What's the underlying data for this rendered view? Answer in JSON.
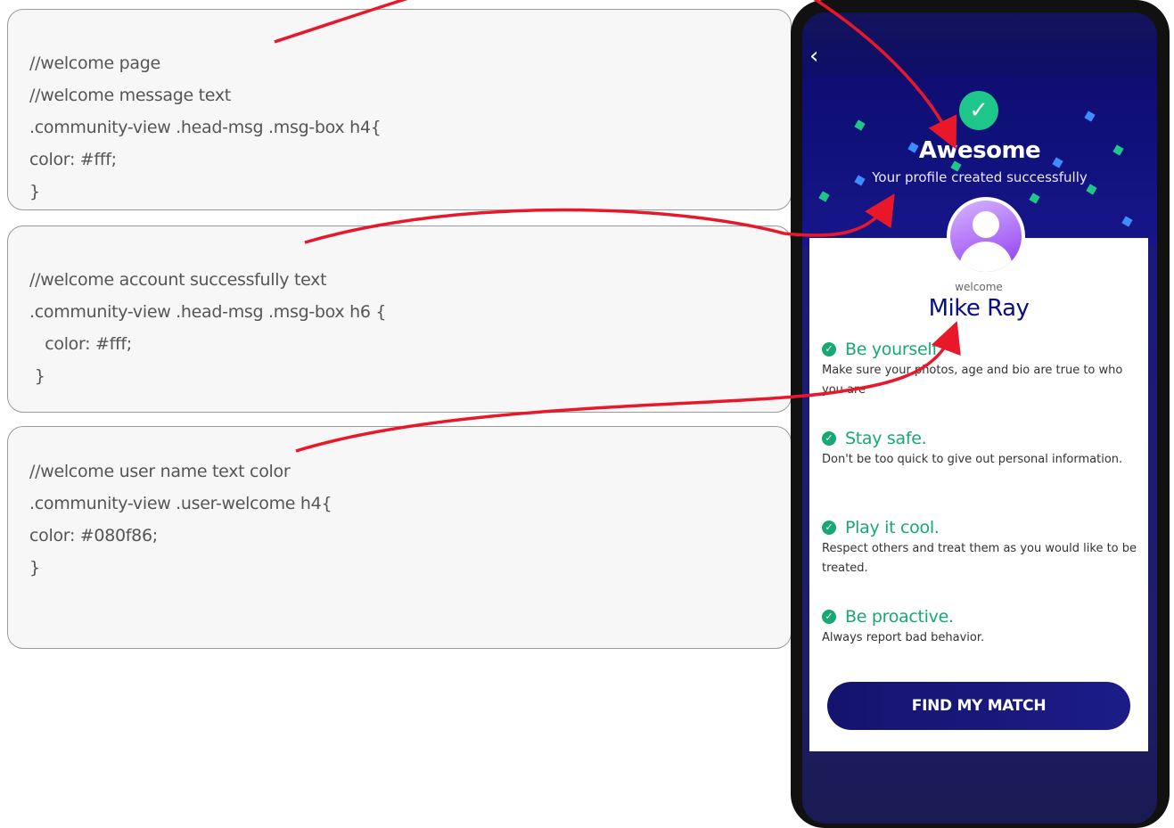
{
  "code_boxes": [
    {
      "lines": [
        "//welcome page",
        "//welcome message text",
        ".community-view .head-msg .msg-box h4{",
        "color: #fff;",
        "}"
      ]
    },
    {
      "lines": [
        "//welcome account successfully text",
        ".community-view .head-msg .msg-box h6 {",
        "   color: #fff;",
        " }"
      ]
    },
    {
      "lines": [
        "//welcome user name text color",
        ".community-view .user-welcome h4{",
        "color: #080f86;",
        "}"
      ]
    }
  ],
  "phone": {
    "back_icon": "chevron-left-icon",
    "hero": {
      "title": "Awesome",
      "subtitle": "Your profile created successfully"
    },
    "welcome_label": "welcome",
    "user_name": "Mike Ray",
    "user_name_color": "#080f86",
    "tips": [
      {
        "title": "Be yourself.",
        "text": "Make sure your photos, age and bio are true to who you are"
      },
      {
        "title": "Stay safe.",
        "text": "Don't be too quick to give out personal information."
      },
      {
        "title": "Play it cool.",
        "text": "Respect others and treat them as you would like to be treated."
      },
      {
        "title": "Be proactive.",
        "text": "Always report bad behavior."
      }
    ],
    "button_label": "FIND MY MATCH"
  },
  "colors": {
    "arrow": "#e8182a",
    "accent_green": "#18a872",
    "brand_navy": "#080f86"
  }
}
